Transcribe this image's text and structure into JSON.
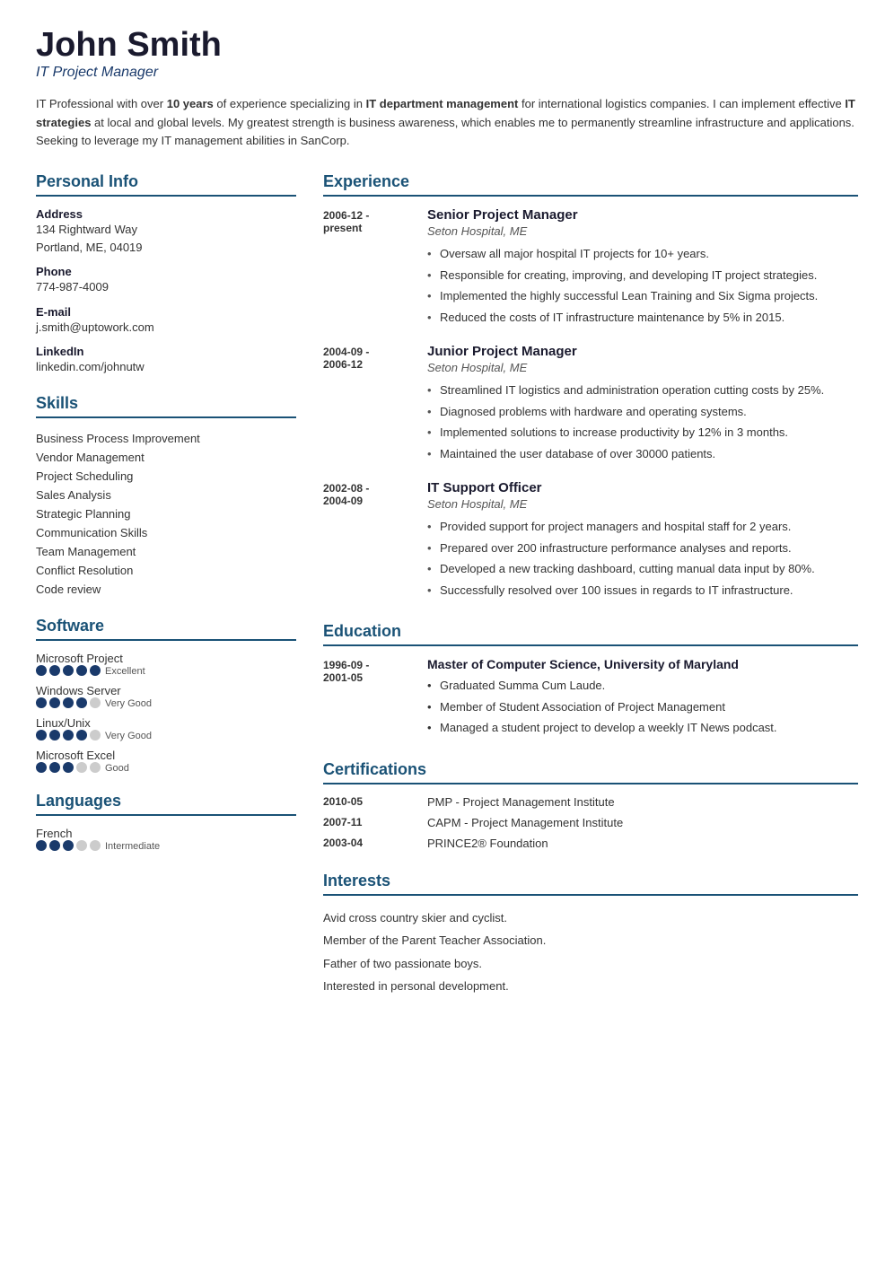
{
  "header": {
    "name": "John Smith",
    "title": "IT Project Manager"
  },
  "summary": {
    "text_parts": [
      "IT Professional with over ",
      "10 years",
      " of experience specializing in ",
      "IT department management",
      " for international logistics companies. I can implement effective ",
      "IT strategies",
      " at local and global levels. My greatest strength is business awareness, which enables me to permanently streamline infrastructure and applications. Seeking to leverage my IT management abilities in SanCorp."
    ]
  },
  "personal_info": {
    "section_title": "Personal Info",
    "address_label": "Address",
    "address_lines": [
      "134 Rightward Way",
      "Portland, ME, 04019"
    ],
    "phone_label": "Phone",
    "phone": "774-987-4009",
    "email_label": "E-mail",
    "email": "j.smith@uptowork.com",
    "linkedin_label": "LinkedIn",
    "linkedin": "linkedin.com/johnutw"
  },
  "skills": {
    "section_title": "Skills",
    "items": [
      "Business Process Improvement",
      "Vendor Management",
      "Project Scheduling",
      "Sales Analysis",
      "Strategic Planning",
      "Communication Skills",
      "Team Management",
      "Conflict Resolution",
      "Code review"
    ]
  },
  "software": {
    "section_title": "Software",
    "items": [
      {
        "name": "Microsoft Project",
        "filled": 5,
        "empty": 0,
        "label": "Excellent"
      },
      {
        "name": "Windows Server",
        "filled": 4,
        "empty": 1,
        "label": "Very Good"
      },
      {
        "name": "Linux/Unix",
        "filled": 4,
        "empty": 1,
        "label": "Very Good"
      },
      {
        "name": "Microsoft Excel",
        "filled": 3,
        "empty": 2,
        "label": "Good"
      }
    ]
  },
  "languages": {
    "section_title": "Languages",
    "items": [
      {
        "name": "French",
        "filled": 3,
        "empty": 2,
        "label": "Intermediate"
      }
    ]
  },
  "experience": {
    "section_title": "Experience",
    "entries": [
      {
        "date_start": "2006-12 -",
        "date_end": "present",
        "job_title": "Senior Project Manager",
        "company": "Seton Hospital, ME",
        "bullets": [
          "Oversaw all major hospital IT projects for 10+ years.",
          "Responsible for creating, improving, and developing IT project strategies.",
          "Implemented the highly successful Lean Training and Six Sigma projects.",
          "Reduced the costs of IT infrastructure maintenance by 5% in 2015."
        ]
      },
      {
        "date_start": "2004-09 -",
        "date_end": "2006-12",
        "job_title": "Junior Project Manager",
        "company": "Seton Hospital, ME",
        "bullets": [
          "Streamlined IT logistics and administration operation cutting costs by 25%.",
          "Diagnosed problems with hardware and operating systems.",
          "Implemented solutions to increase productivity by 12% in 3 months.",
          "Maintained the user database of over 30000 patients."
        ]
      },
      {
        "date_start": "2002-08 -",
        "date_end": "2004-09",
        "job_title": "IT Support Officer",
        "company": "Seton Hospital, ME",
        "bullets": [
          "Provided support for project managers and hospital staff for 2 years.",
          "Prepared over 200 infrastructure performance analyses and reports.",
          "Developed a new tracking dashboard, cutting manual data input by 80%.",
          "Successfully resolved over 100 issues in regards to IT infrastructure."
        ]
      }
    ]
  },
  "education": {
    "section_title": "Education",
    "entries": [
      {
        "date_start": "1996-09 -",
        "date_end": "2001-05",
        "degree": "Master of Computer Science, University of Maryland",
        "bullets": [
          "Graduated Summa Cum Laude.",
          "Member of Student Association of Project Management",
          "Managed a student project to develop a weekly IT News podcast."
        ]
      }
    ]
  },
  "certifications": {
    "section_title": "Certifications",
    "entries": [
      {
        "date": "2010-05",
        "name": "PMP - Project Management Institute"
      },
      {
        "date": "2007-11",
        "name": "CAPM - Project Management Institute"
      },
      {
        "date": "2003-04",
        "name": "PRINCE2® Foundation"
      }
    ]
  },
  "interests": {
    "section_title": "Interests",
    "items": [
      "Avid cross country skier and cyclist.",
      "Member of the Parent Teacher Association.",
      "Father of two passionate boys.",
      "Interested in personal development."
    ]
  }
}
